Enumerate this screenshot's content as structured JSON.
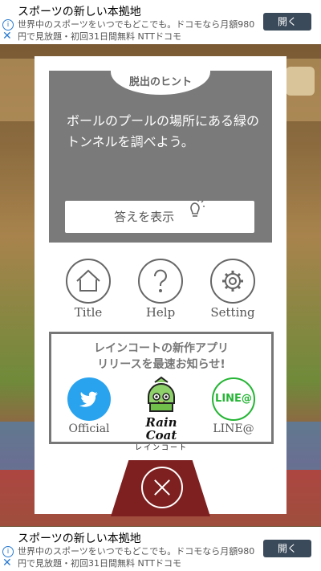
{
  "ad_top": {
    "title": "スポーツの新しい本拠地",
    "body": "世界中のスポーツをいつでもどこでも。ドコモなら月額980円で見放題・初回31日間無料 NTTドコモ",
    "button": "開く"
  },
  "ad_bottom": {
    "title": "スポーツの新しい本拠地",
    "body": "世界中のスポーツをいつでもどこでも。ドコモなら月額980円で見放題・初回31日間無料 NTTドコモ",
    "button": "開く"
  },
  "hint": {
    "tab_label": "脱出のヒント",
    "text": "ボールのプールの場所にある緑のトンネルを調べよう。",
    "answer_button": "答えを表示"
  },
  "menu": {
    "title_label": "Title",
    "help_label": "Help",
    "setting_label": "Setting"
  },
  "promo": {
    "text_line1": "レインコートの新作アプリ",
    "text_line2": "リリースを最速お知らせ!",
    "twitter_label": "Official",
    "logo_name": "Rain Coat",
    "logo_sub": "レインコート",
    "line_label": "LINE@",
    "line_badge": "LINE@"
  },
  "colors": {
    "accent_twitter": "#2aa3ef",
    "accent_line": "#25b535",
    "close_bg": "#7e2020",
    "hint_bg": "#7a7a7a"
  }
}
